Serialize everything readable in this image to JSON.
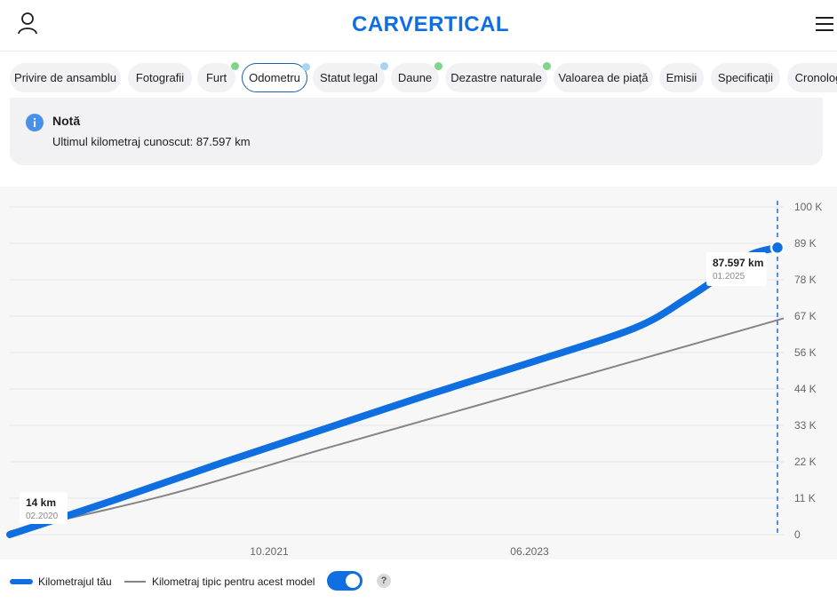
{
  "header": {
    "logo_text": "CARVERTICAL",
    "icons": {
      "user": "user-icon",
      "menu": "hamburger-menu-icon"
    },
    "brand_color": "#0f6fe1"
  },
  "tabs": [
    {
      "label": "Privire de ansamblu",
      "active": false,
      "dot": ""
    },
    {
      "label": "Fotografii",
      "active": false,
      "dot": ""
    },
    {
      "label": "Furt",
      "active": false,
      "dot": "#7fd48a"
    },
    {
      "label": "Odometru",
      "active": true,
      "dot": "#a9d3f5"
    },
    {
      "label": "Statut legal",
      "active": false,
      "dot": "#a9d3f5"
    },
    {
      "label": "Daune",
      "active": false,
      "dot": "#7fd48a"
    },
    {
      "label": "Dezastre naturale",
      "active": false,
      "dot": "#7fd48a"
    },
    {
      "label": "Valoarea de piață",
      "active": false,
      "dot": ""
    },
    {
      "label": "Emisii",
      "active": false,
      "dot": ""
    },
    {
      "label": "Specificații",
      "active": false,
      "dot": ""
    },
    {
      "label": "Cronolog",
      "active": false,
      "dot": ""
    }
  ],
  "note": {
    "title": "Notă",
    "text": "Ultimul kilometraj cunoscut: 87.597 km",
    "icon": "info-icon"
  },
  "chart_data": {
    "type": "line",
    "y_ticks": [
      "100 K",
      "89 K",
      "78 K",
      "67 K",
      "56 K",
      "44 K",
      "33 K",
      "22 K",
      "11 K",
      "0"
    ],
    "ylim": [
      0,
      100000
    ],
    "x_ticks": [
      "10.2021",
      "06.2023"
    ],
    "xlim": [
      "2020-02",
      "2025-01"
    ],
    "grid": true,
    "legend": "bottom-left",
    "series": [
      {
        "name": "Kilometrajul tău",
        "color": "#0f6fe1",
        "points": [
          {
            "x": "2020-02",
            "y": 14
          },
          {
            "x": "2020-10",
            "y": 10500
          },
          {
            "x": "2021-06",
            "y": 21500
          },
          {
            "x": "2022-02",
            "y": 32000
          },
          {
            "x": "2022-10",
            "y": 42500
          },
          {
            "x": "2023-06",
            "y": 52500
          },
          {
            "x": "2024-02",
            "y": 63000
          },
          {
            "x": "2024-06",
            "y": 72000
          },
          {
            "x": "2024-09",
            "y": 80000
          },
          {
            "x": "2024-11",
            "y": 85500
          },
          {
            "x": "2025-01",
            "y": 87597
          }
        ]
      },
      {
        "name": "Kilometraj tipic pentru acest model",
        "color": "#858585",
        "points": [
          {
            "x": "2020-02",
            "y": 1000
          },
          {
            "x": "2021-02",
            "y": 12000
          },
          {
            "x": "2022-02",
            "y": 26000
          },
          {
            "x": "2023-02",
            "y": 39500
          },
          {
            "x": "2024-02",
            "y": 53000
          },
          {
            "x": "2025-01",
            "y": 66000
          }
        ]
      }
    ],
    "annotations": [
      {
        "value": "14 km",
        "date": "02.2020"
      },
      {
        "value": "87.597 km",
        "date": "01.2025"
      }
    ],
    "marker_line_color": "#1f6fe0"
  },
  "legend": {
    "own_label": "Kilometrajul tău",
    "typical_label": "Kilometraj tipic pentru acest model",
    "toggle_on": true,
    "help_text": "?"
  }
}
